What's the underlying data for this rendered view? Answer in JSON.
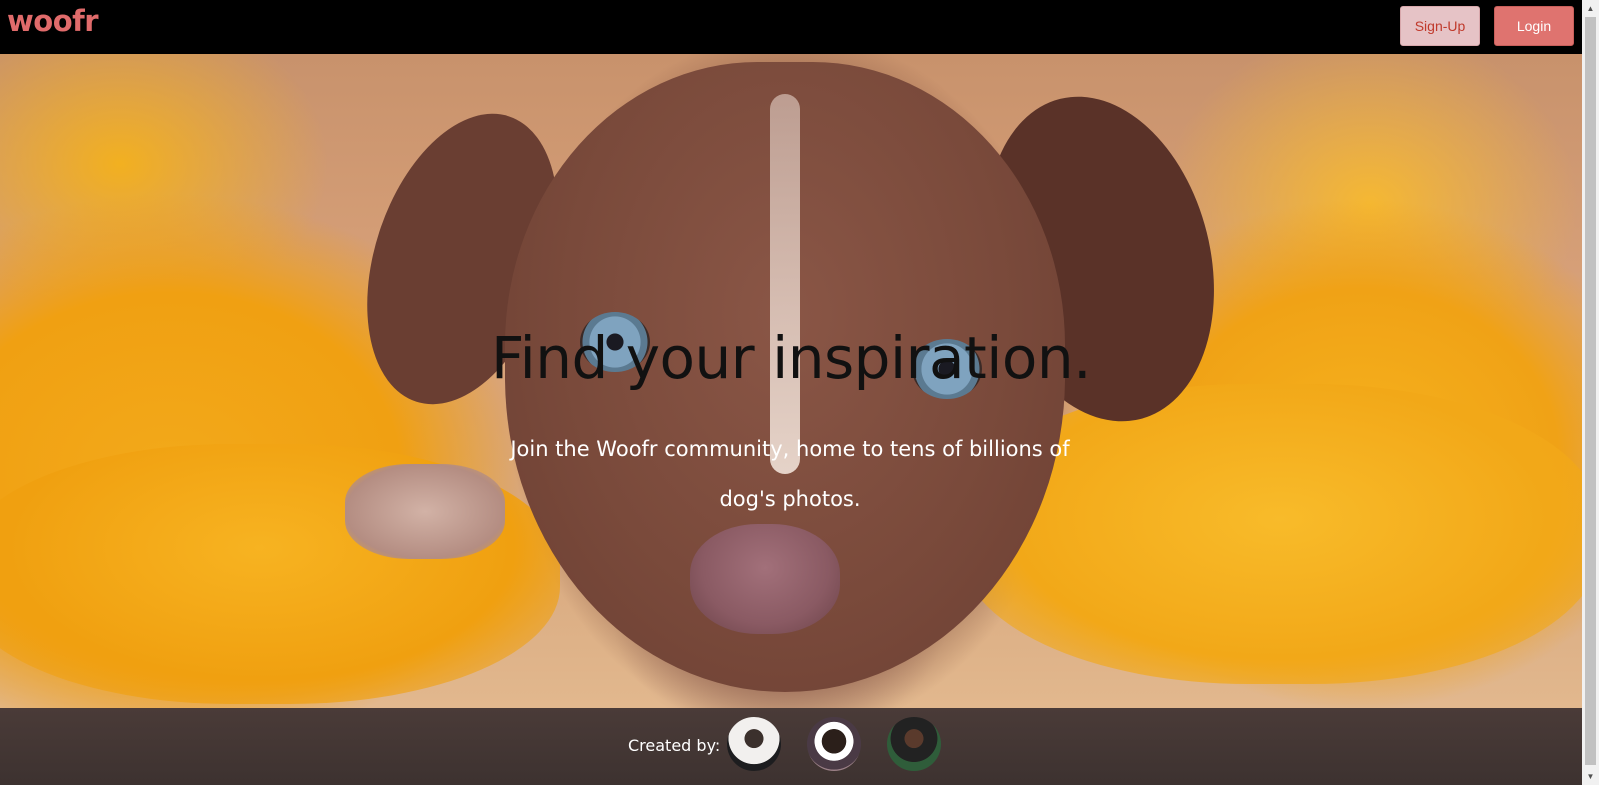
{
  "header": {
    "logo": "woofr",
    "signup_label": "Sign-Up",
    "login_label": "Login"
  },
  "hero": {
    "title": "Find your inspiration.",
    "subtitle": "Join the Woofr community, home to tens of billions of dog's photos."
  },
  "footer": {
    "created_by": "Created by:"
  },
  "scrollbar": {
    "up_icon": "▲",
    "down_icon": "▼"
  },
  "colors": {
    "brand": "#e06b6b",
    "signup_bg": "#e6c3c6",
    "login_bg": "#df736f",
    "footer_bg": "#45383a"
  }
}
